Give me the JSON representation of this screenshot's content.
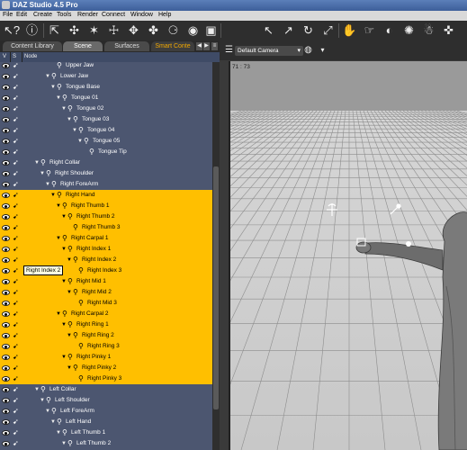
{
  "window": {
    "title": "DAZ Studio 4.5 Pro"
  },
  "menu": [
    "File",
    "Edit",
    "Create",
    "Tools",
    "Render",
    "Connect",
    "Window",
    "Help"
  ],
  "toolbar_icons": [
    "help-cursor-icon",
    "help-icon",
    "node-select-icon",
    "universal-tool-icon",
    "joint-editor-icon",
    "pose-tool-icon",
    "region-nav-icon",
    "active-pose-icon",
    "spot-render-icon",
    "surface-selection-icon",
    "geometry-editor-icon",
    "node-select-tool-icon",
    "translate-tool-icon",
    "rotate-tool-icon",
    "scale-tool-icon",
    "pose-icon",
    "posable-icon",
    "render-icon",
    "lights-icon",
    "figure-icon",
    "camera-icon",
    "shaping-icon",
    "surface-icon",
    "settings-icon"
  ],
  "tabs": [
    "Content Library",
    "Scene",
    "Surfaces",
    "Smart Conte"
  ],
  "active_tab": "Scene",
  "columns": [
    "V",
    "S",
    "Node"
  ],
  "camera": {
    "selected": "Default Camera"
  },
  "viewport_readout": "71 : 73",
  "tooltip": "Right Index 2",
  "tree": [
    {
      "label": "Upper Jaw",
      "depth": 7,
      "expand": false,
      "selected": false
    },
    {
      "label": "Lower Jaw",
      "depth": 6,
      "expand": true,
      "selected": false
    },
    {
      "label": "Tongue Base",
      "depth": 7,
      "expand": true,
      "selected": false
    },
    {
      "label": "Tongue 01",
      "depth": 8,
      "expand": true,
      "selected": false
    },
    {
      "label": "Tongue 02",
      "depth": 9,
      "expand": true,
      "selected": false
    },
    {
      "label": "Tongue 03",
      "depth": 10,
      "expand": true,
      "selected": false
    },
    {
      "label": "Tongue 04",
      "depth": 11,
      "expand": true,
      "selected": false
    },
    {
      "label": "Tongue 05",
      "depth": 12,
      "expand": true,
      "selected": false
    },
    {
      "label": "Tongue Tip",
      "depth": 13,
      "expand": false,
      "selected": false
    },
    {
      "label": "Right Collar",
      "depth": 4,
      "expand": true,
      "selected": false
    },
    {
      "label": "Right Shoulder",
      "depth": 5,
      "expand": true,
      "selected": false
    },
    {
      "label": "Right ForeArm",
      "depth": 6,
      "expand": true,
      "selected": false
    },
    {
      "label": "Right Hand",
      "depth": 7,
      "expand": true,
      "selected": true
    },
    {
      "label": "Right Thumb 1",
      "depth": 8,
      "expand": true,
      "selected": true
    },
    {
      "label": "Right Thumb 2",
      "depth": 9,
      "expand": true,
      "selected": true
    },
    {
      "label": "Right Thumb 3",
      "depth": 10,
      "expand": false,
      "selected": true
    },
    {
      "label": "Right Carpal 1",
      "depth": 8,
      "expand": true,
      "selected": true
    },
    {
      "label": "Right Index 1",
      "depth": 9,
      "expand": true,
      "selected": true
    },
    {
      "label": "Right Index 2",
      "depth": 10,
      "expand": true,
      "selected": true
    },
    {
      "label": "Right Index 3",
      "depth": 11,
      "expand": false,
      "selected": true
    },
    {
      "label": "Right Mid 1",
      "depth": 9,
      "expand": true,
      "selected": true
    },
    {
      "label": "Right Mid 2",
      "depth": 10,
      "expand": true,
      "selected": true
    },
    {
      "label": "Right Mid 3",
      "depth": 11,
      "expand": false,
      "selected": true
    },
    {
      "label": "Right Carpal 2",
      "depth": 8,
      "expand": true,
      "selected": true
    },
    {
      "label": "Right Ring 1",
      "depth": 9,
      "expand": true,
      "selected": true
    },
    {
      "label": "Right Ring 2",
      "depth": 10,
      "expand": true,
      "selected": true
    },
    {
      "label": "Right Ring 3",
      "depth": 11,
      "expand": false,
      "selected": true
    },
    {
      "label": "Right Pinky 1",
      "depth": 9,
      "expand": true,
      "selected": true
    },
    {
      "label": "Right Pinky 2",
      "depth": 10,
      "expand": true,
      "selected": true
    },
    {
      "label": "Right Pinky 3",
      "depth": 11,
      "expand": false,
      "selected": true
    },
    {
      "label": "Left Collar",
      "depth": 4,
      "expand": true,
      "selected": false
    },
    {
      "label": "Left Shoulder",
      "depth": 5,
      "expand": true,
      "selected": false
    },
    {
      "label": "Left ForeArm",
      "depth": 6,
      "expand": true,
      "selected": false
    },
    {
      "label": "Left Hand",
      "depth": 7,
      "expand": true,
      "selected": false
    },
    {
      "label": "Left Thumb 1",
      "depth": 8,
      "expand": true,
      "selected": false
    },
    {
      "label": "Left Thumb 2",
      "depth": 9,
      "expand": true,
      "selected": false
    }
  ],
  "colors": {
    "selection": "#ffbf00",
    "tree_bg": "#4c5670",
    "title_bar": "#4a6ea8",
    "tab_accent": "#f2a900"
  }
}
